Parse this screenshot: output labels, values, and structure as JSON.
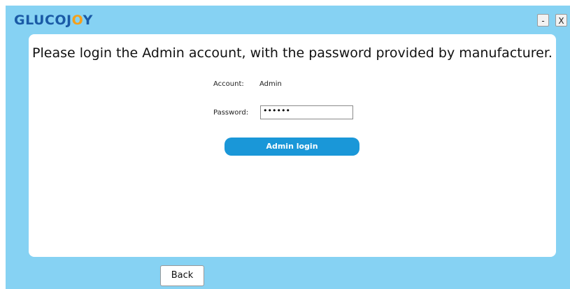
{
  "app": {
    "logo_part1": "GLUCOJ",
    "logo_part2": "O",
    "logo_part3": "Y",
    "minimize_label": "-",
    "close_label": "X"
  },
  "login": {
    "title": "Please login the Admin account, with the password provided by manufacturer.",
    "account_label": "Account:",
    "account_value": "Admin",
    "password_label": "Password:",
    "password_value": "••••••",
    "submit_label": "Admin login"
  },
  "footer": {
    "back_label": "Back"
  },
  "colors": {
    "window_bg": "#86d2f3",
    "logo_blue": "#1a5aa6",
    "logo_orange": "#f5a01a",
    "button_blue": "#1a97d8"
  }
}
